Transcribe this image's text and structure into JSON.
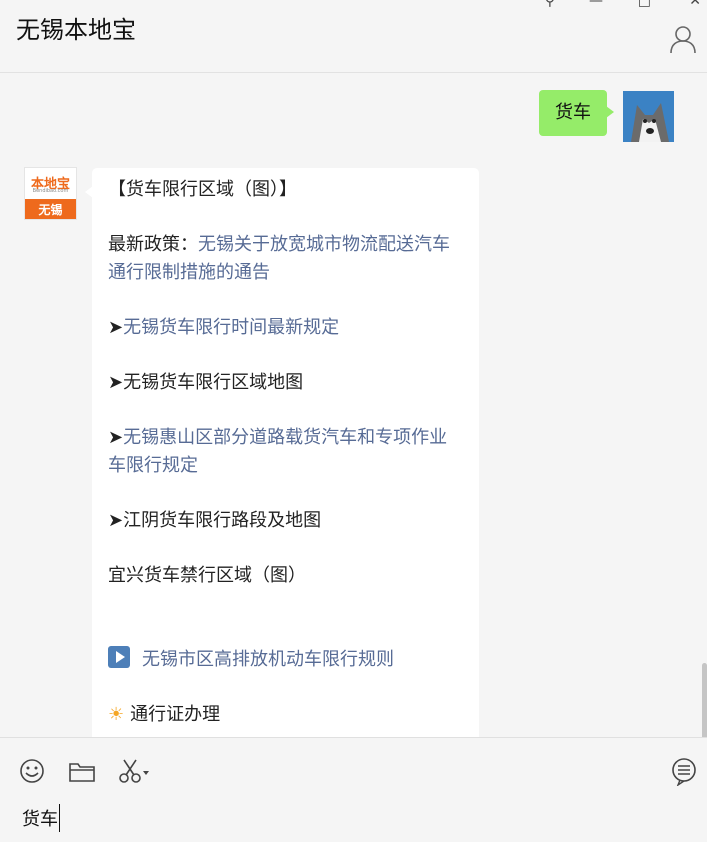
{
  "header": {
    "title": "无锡本地宝",
    "controls": {
      "pin": "⚲",
      "minimize": "—",
      "maximize": "□",
      "close": "✕"
    }
  },
  "chat": {
    "self_message": "货车",
    "other_avatar": {
      "top_text": "本地宝",
      "url_text": "Bendibao.com",
      "bottom_text": "无锡"
    },
    "reply": {
      "title": "【货车限行区域（图）】",
      "policy_prefix": "最新政策：",
      "policy_link": "无锡关于放宽城市物流配送汽车通行限制措施的通告",
      "arrow": "➤",
      "item1": "无锡货车限行时间最新规定",
      "item2": "无锡货车限行区域地图",
      "item3": "无锡惠山区部分道路载货汽车和专项作业车限行规定",
      "item4": "江阴货车限行路段及地图",
      "item5": "宜兴货车禁行区域（图）",
      "item6": "无锡市区高排放机动车限行规则",
      "item7": "通行证办理"
    }
  },
  "input": {
    "value": "货车"
  },
  "colors": {
    "self_bubble": "#95ec69",
    "link": "#576b95",
    "brand_orange": "#ee6a1d"
  }
}
